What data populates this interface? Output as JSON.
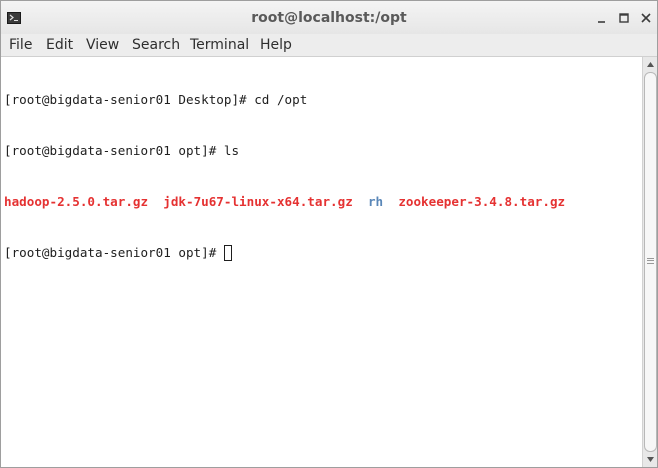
{
  "window": {
    "title": "root@localhost:/opt",
    "controls": {
      "minimize": "_",
      "maximize": "□",
      "close": "✕"
    }
  },
  "menubar": {
    "items": [
      "File",
      "Edit",
      "View",
      "Search",
      "Terminal",
      "Help"
    ]
  },
  "terminal": {
    "line1": "[root@bigdata-senior01 Desktop]# cd /opt",
    "line2": "[root@bigdata-senior01 opt]# ls",
    "ls_output": [
      {
        "name": "hadoop-2.5.0.tar.gz",
        "type": "archive"
      },
      {
        "name": "jdk-7u67-linux-x64.tar.gz",
        "type": "archive"
      },
      {
        "name": "rh",
        "type": "directory"
      },
      {
        "name": "zookeeper-3.4.8.tar.gz",
        "type": "archive"
      }
    ],
    "prompt": "[root@bigdata-senior01 opt]# "
  },
  "colors": {
    "archive": "#e53232",
    "directory": "#5a87b8"
  },
  "icons": {
    "app": "terminal-icon",
    "scroll_up": "arrow-up-icon",
    "scroll_down": "arrow-down-icon"
  }
}
